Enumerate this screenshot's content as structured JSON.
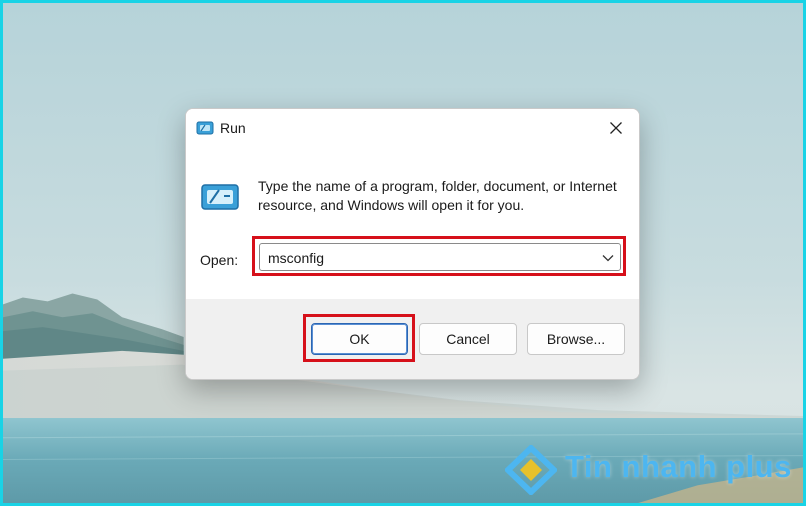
{
  "dialog": {
    "title": "Run",
    "description": "Type the name of a program, folder, document, or Internet resource, and Windows will open it for you.",
    "open_label": "Open:",
    "open_value": "msconfig",
    "buttons": {
      "ok": "OK",
      "cancel": "Cancel",
      "browse": "Browse..."
    }
  },
  "icons": {
    "title": "run-app-icon",
    "content": "run-app-icon",
    "close": "close-icon",
    "dropdown": "chevron-down-icon"
  },
  "watermark": {
    "text": "Tin nhanh plus"
  },
  "colors": {
    "highlight": "#d6101a",
    "frame": "#19d3e6",
    "accent": "#2b66b3",
    "watermark": "#4db6f0"
  }
}
